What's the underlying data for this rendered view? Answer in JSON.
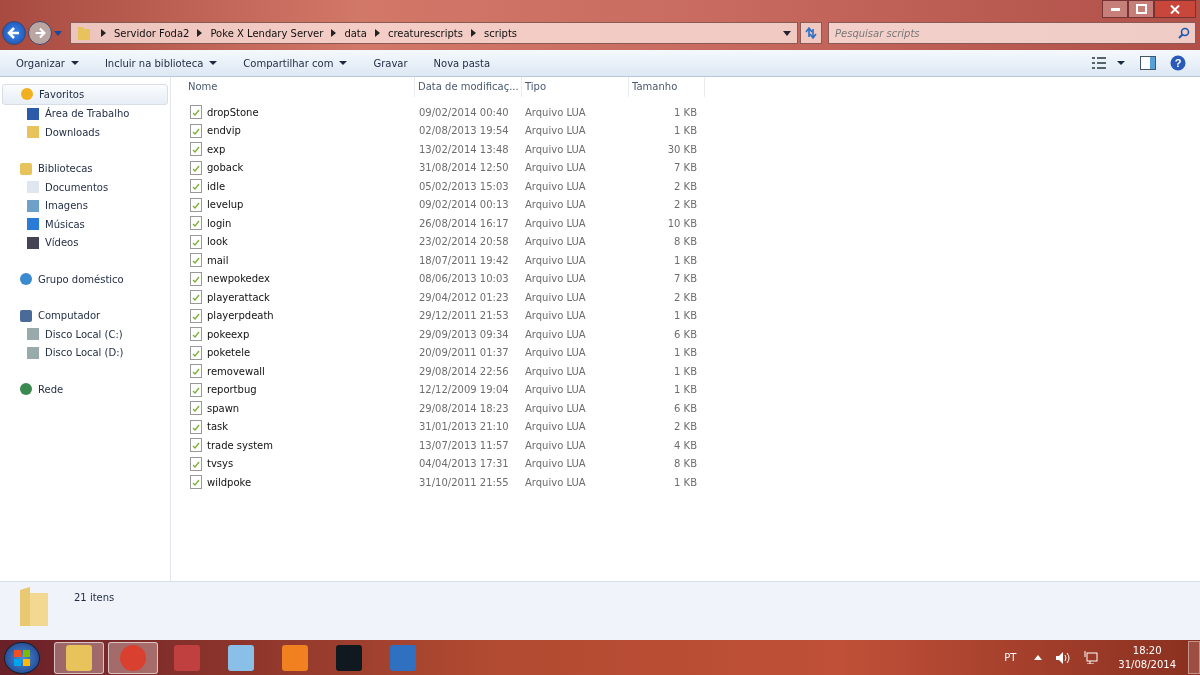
{
  "address_bar": {
    "segments": [
      "Servidor Foda2",
      "Poke X Lendary Server",
      "data",
      "creaturescripts",
      "scripts"
    ]
  },
  "search": {
    "placeholder": "Pesquisar scripts"
  },
  "toolbar": {
    "items": [
      {
        "label": "Organizar",
        "dropdown": true
      },
      {
        "label": "Incluir na biblioteca",
        "dropdown": true
      },
      {
        "label": "Compartilhar com",
        "dropdown": true
      },
      {
        "label": "Gravar",
        "dropdown": false
      },
      {
        "label": "Nova pasta",
        "dropdown": false
      }
    ]
  },
  "sidebar": {
    "groups": [
      {
        "label": "Favoritos",
        "kind": "star",
        "selected": true,
        "children": [
          {
            "label": "Área de Trabalho",
            "kind": "desktop",
            "selected": false
          },
          {
            "label": "Downloads",
            "kind": "folder",
            "selected": false
          }
        ]
      },
      {
        "label": "Bibliotecas",
        "kind": "library",
        "selected": false,
        "children": [
          {
            "label": "Documentos",
            "kind": "document",
            "selected": false
          },
          {
            "label": "Imagens",
            "kind": "image",
            "selected": false
          },
          {
            "label": "Músicas",
            "kind": "music",
            "selected": false
          },
          {
            "label": "Vídeos",
            "kind": "video",
            "selected": false
          }
        ]
      },
      {
        "label": "Grupo doméstico",
        "kind": "homegroup",
        "selected": false
      },
      {
        "label": "Computador",
        "kind": "computer",
        "selected": false,
        "children": [
          {
            "label": "Disco Local (C:)",
            "kind": "drive",
            "selected": false
          },
          {
            "label": "Disco Local (D:)",
            "kind": "drive",
            "selected": false
          }
        ]
      },
      {
        "label": "Rede",
        "kind": "network",
        "selected": false
      }
    ]
  },
  "table": {
    "columns": [
      "Nome",
      "Data de modificaç...",
      "Tipo",
      "Tamanho"
    ],
    "rows": [
      [
        "dropStone",
        "09/02/2014 00:40",
        "Arquivo LUA",
        "1 KB"
      ],
      [
        "endvip",
        "02/08/2013 19:54",
        "Arquivo LUA",
        "1 KB"
      ],
      [
        "exp",
        "13/02/2014 13:48",
        "Arquivo LUA",
        "30 KB"
      ],
      [
        "goback",
        "31/08/2014 12:50",
        "Arquivo LUA",
        "7 KB"
      ],
      [
        "idle",
        "05/02/2013 15:03",
        "Arquivo LUA",
        "2 KB"
      ],
      [
        "levelup",
        "09/02/2014 00:13",
        "Arquivo LUA",
        "2 KB"
      ],
      [
        "login",
        "26/08/2014 16:17",
        "Arquivo LUA",
        "10 KB"
      ],
      [
        "look",
        "23/02/2014 20:58",
        "Arquivo LUA",
        "8 KB"
      ],
      [
        "mail",
        "18/07/2011 19:42",
        "Arquivo LUA",
        "1 KB"
      ],
      [
        "newpokedex",
        "08/06/2013 10:03",
        "Arquivo LUA",
        "7 KB"
      ],
      [
        "playerattack",
        "29/04/2012 01:23",
        "Arquivo LUA",
        "2 KB"
      ],
      [
        "playerpdeath",
        "29/12/2011 21:53",
        "Arquivo LUA",
        "1 KB"
      ],
      [
        "pokeexp",
        "29/09/2013 09:34",
        "Arquivo LUA",
        "6 KB"
      ],
      [
        "poketele",
        "20/09/2011 01:37",
        "Arquivo LUA",
        "1 KB"
      ],
      [
        "removewall",
        "29/08/2014 22:56",
        "Arquivo LUA",
        "1 KB"
      ],
      [
        "reportbug",
        "12/12/2009 19:04",
        "Arquivo LUA",
        "1 KB"
      ],
      [
        "spawn",
        "29/08/2014 18:23",
        "Arquivo LUA",
        "6 KB"
      ],
      [
        "task",
        "31/01/2013 21:10",
        "Arquivo LUA",
        "2 KB"
      ],
      [
        "trade system",
        "13/07/2013 11:57",
        "Arquivo LUA",
        "4 KB"
      ],
      [
        "tvsys",
        "04/04/2013 17:31",
        "Arquivo LUA",
        "8 KB"
      ],
      [
        "wildpoke",
        "31/10/2011 21:55",
        "Arquivo LUA",
        "1 KB"
      ]
    ]
  },
  "help_button": {
    "label": "?"
  },
  "status_bar": {
    "count": "21 itens"
  },
  "taskbar": {
    "apps": [
      {
        "kind": "explorer",
        "active": true
      },
      {
        "kind": "chrome",
        "active": true
      },
      {
        "kind": "scissors",
        "active": false
      },
      {
        "kind": "calculator",
        "active": false
      },
      {
        "kind": "media",
        "active": false
      },
      {
        "kind": "pb",
        "active": false
      },
      {
        "kind": "game",
        "active": false
      }
    ],
    "language": "PT",
    "time": "18:20",
    "date": "31/08/2014"
  }
}
